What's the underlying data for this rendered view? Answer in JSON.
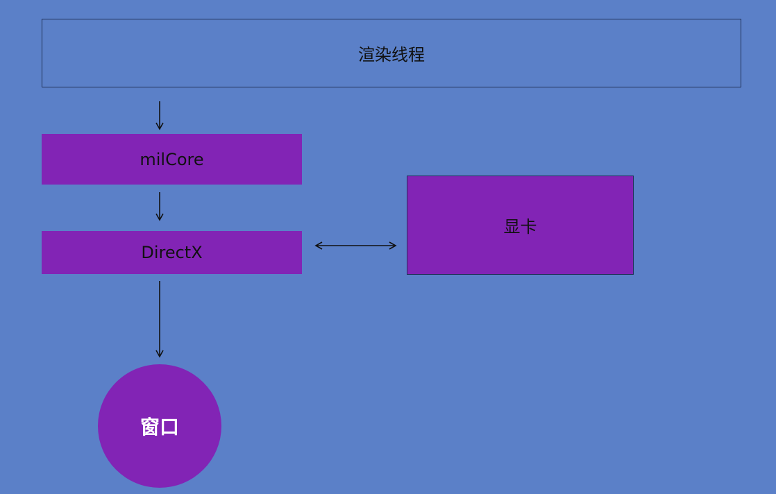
{
  "nodes": {
    "render_thread": "渲染线程",
    "milcore": "milCore",
    "directx": "DirectX",
    "gpu": "显卡",
    "window": "窗口"
  },
  "colors": {
    "background": "#5b80c8",
    "node_fill": "#8224b5",
    "border": "#1f2f55",
    "arrow": "#111111"
  }
}
